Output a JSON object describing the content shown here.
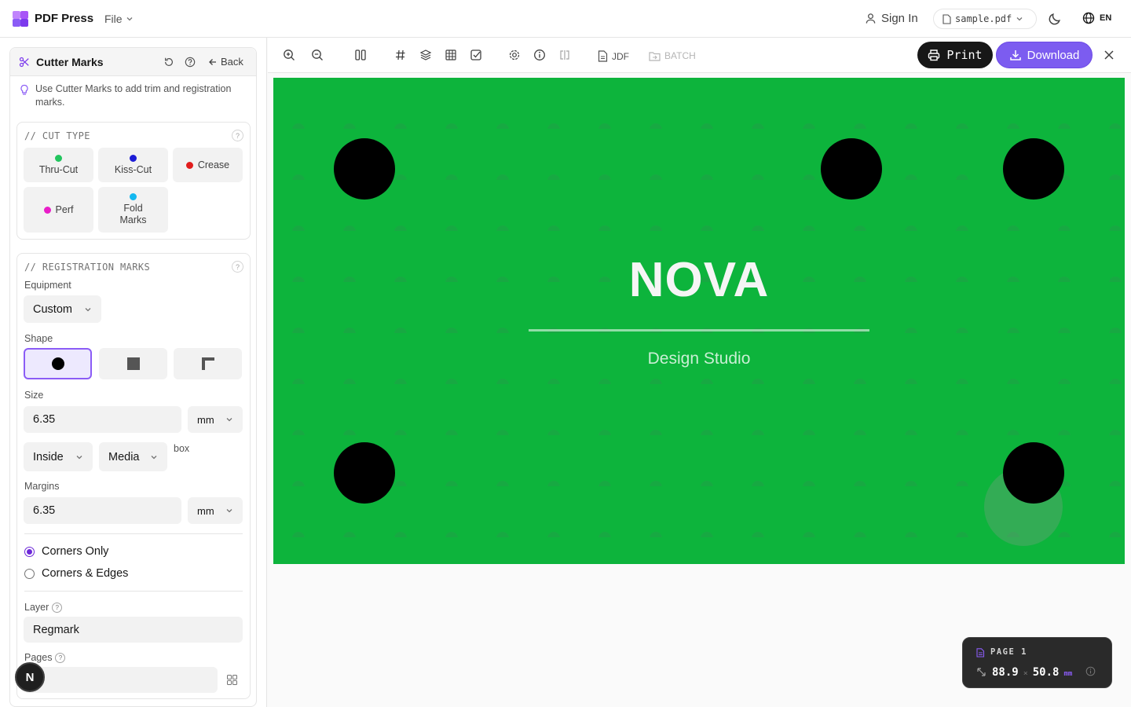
{
  "app": {
    "name": "PDF Press",
    "file_menu": "File"
  },
  "header": {
    "sign_in": "Sign In",
    "file_name": "sample.pdf",
    "language": "EN"
  },
  "panel": {
    "title": "Cutter Marks",
    "back_label": "Back",
    "tip": "Use Cutter Marks to add trim and registration marks.",
    "cut_type": {
      "title": "// CUT TYPE",
      "options": [
        {
          "label": "Thru-Cut",
          "color": "#22c55e"
        },
        {
          "label": "Kiss-Cut",
          "color": "#1d1dd6"
        },
        {
          "label": "Crease",
          "color": "#e11d1d"
        },
        {
          "label": "Perf",
          "color": "#e91ec8"
        },
        {
          "label": "Fold Marks",
          "color": "#14b8f0"
        }
      ]
    },
    "registration": {
      "title": "// REGISTRATION MARKS",
      "equipment_label": "Equipment",
      "equipment_value": "Custom",
      "shape_label": "Shape",
      "shapes": [
        "circle",
        "square",
        "corner"
      ],
      "selected_shape": "circle",
      "size_label": "Size",
      "size_value": "6.35",
      "size_unit": "mm",
      "position_value": "Inside",
      "box_value": "Media",
      "box_suffix": "box",
      "margins_label": "Margins",
      "margins_value": "6.35",
      "margins_unit": "mm",
      "placement_options": [
        "Corners Only",
        "Corners & Edges"
      ],
      "placement_selected": "Corners Only",
      "layer_label": "Layer",
      "layer_value": "Regmark",
      "pages_label": "Pages",
      "pages_value": ""
    }
  },
  "toolbar": {
    "jdf_label": "JDF",
    "batch_label": "BATCH",
    "print_label": "Print",
    "download_label": "Download"
  },
  "document": {
    "title": "NOVA",
    "subtitle": "Design Studio",
    "background_color": "#0db43c"
  },
  "page_info": {
    "label": "PAGE 1",
    "width": "88.9",
    "separator": "×",
    "height": "50.8",
    "unit": "mm"
  },
  "avatar_letter": "N"
}
